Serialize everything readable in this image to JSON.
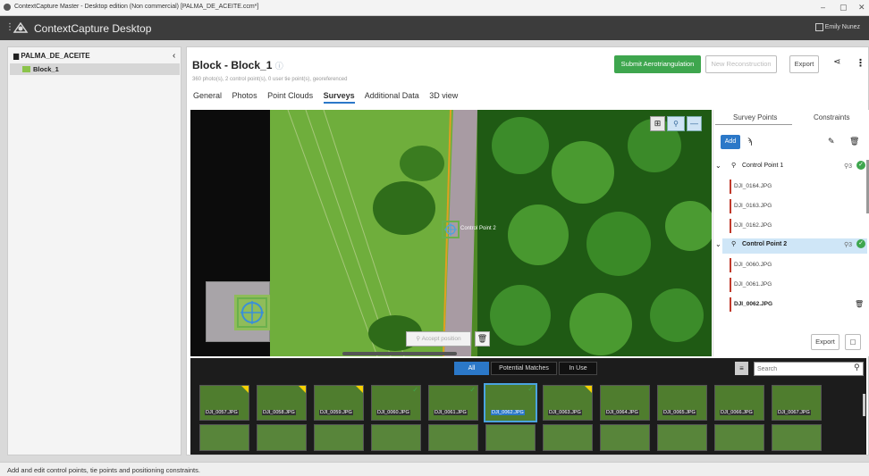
{
  "window": {
    "title": "ContextCapture Master - Desktop edition (Non commercial) [PALMA_DE_ACEITE.ccm*]"
  },
  "app": {
    "name": "ContextCapture Desktop",
    "user": "Emily Nunez"
  },
  "tree": {
    "project": "PALMA_DE_ACEITE",
    "block": "Block_1"
  },
  "block": {
    "title": "Block - Block_1",
    "subtitle": "360 photo(s), 2 control point(s), 0 user tie point(s), georeferenced"
  },
  "toolbar": {
    "submit": "Submit Aerotriangulation",
    "new_recon": "New Reconstruction",
    "export": "Export"
  },
  "tabs": [
    "General",
    "Photos",
    "Point Clouds",
    "Surveys",
    "Additional Data",
    "3D view"
  ],
  "active_tab": "Surveys",
  "viewer": {
    "marker_label": "Control Point 2",
    "accept_button": "Accept position"
  },
  "survey": {
    "tabs": [
      "Survey Points",
      "Constraints"
    ],
    "add_label": "Add",
    "points": [
      {
        "name": "Control Point 1",
        "count": "3",
        "images": [
          "DJI_0164.JPG",
          "DJI_0163.JPG",
          "DJI_0162.JPG"
        ]
      },
      {
        "name": "Control Point 2",
        "count": "3",
        "images": [
          "DJI_0060.JPG",
          "DJI_0061.JPG",
          "DJI_0062.JPG"
        ]
      }
    ],
    "export_label": "Export"
  },
  "filter": {
    "all": "All",
    "potential": "Potential Matches",
    "in_use": "In Use",
    "search_placeholder": "Search"
  },
  "thumbnails": [
    "DJI_0057.JPG",
    "DJI_0058.JPG",
    "DJI_0059.JPG",
    "DJI_0060.JPG",
    "DJI_0061.JPG",
    "DJI_0062.JPG",
    "DJI_0063.JPG",
    "DJI_0064.JPG",
    "DJI_0065.JPG",
    "DJI_0066.JPG",
    "DJI_0067.JPG"
  ],
  "status": {
    "text": "Add and edit control points, tie points and positioning constraints."
  }
}
